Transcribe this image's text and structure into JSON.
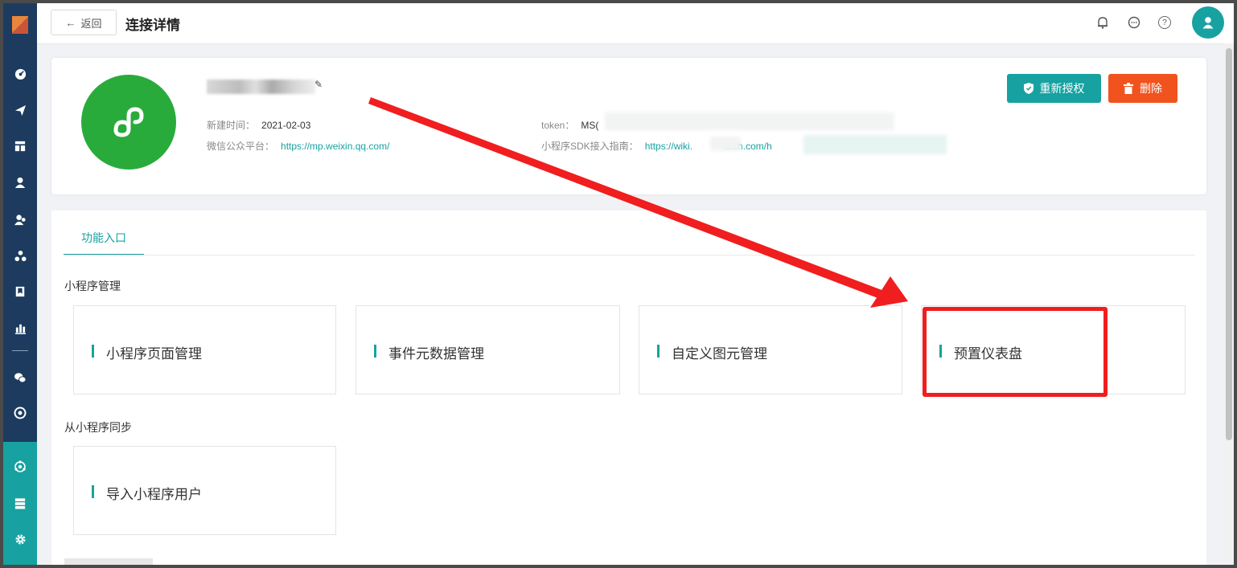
{
  "topbar": {
    "back_label": "返回",
    "title": "连接详情",
    "icons": [
      "bell-icon",
      "chat-icon",
      "help-icon",
      "user-avatar-icon"
    ]
  },
  "sidebar": {
    "icons": [
      "dashboard-icon",
      "send-icon",
      "layout-icon",
      "user-icon",
      "users-icon",
      "cluster-icon",
      "bookmark-icon",
      "bar-chart-icon",
      "wechat-icon",
      "target-icon",
      "connect-icon",
      "server-icon",
      "gear-icon"
    ]
  },
  "app": {
    "created_label": "新建时间：",
    "created_value": "2021-02-03",
    "platform_label": "微信公众平台：",
    "platform_link": "https://mp.weixin.qq.com/",
    "token_label": "token：",
    "token_value": "MS(",
    "sdk_label": "小程序SDK接入指南：",
    "sdk_link_prefix": "https://wiki.",
    "sdk_link_middle": "tech.com/",
    "sdk_link_suffix": "h"
  },
  "actions": {
    "reauth_label": "重新授权",
    "delete_label": "删除"
  },
  "tabs": [
    {
      "label": "功能入口"
    }
  ],
  "sections": [
    {
      "title": "小程序管理",
      "entries": [
        {
          "label": "小程序页面管理"
        },
        {
          "label": "事件元数据管理"
        },
        {
          "label": "自定义图元管理"
        },
        {
          "label": "预置仪表盘"
        }
      ]
    },
    {
      "title": "从小程序同步",
      "entries": [
        {
          "label": "导入小程序用户"
        }
      ]
    }
  ],
  "colors": {
    "accent": "#17a2a1",
    "sidebar": "#1c3b5f",
    "danger": "#f1531f",
    "annotation": "#f01e1e",
    "app_logo": "#29ab3c"
  }
}
